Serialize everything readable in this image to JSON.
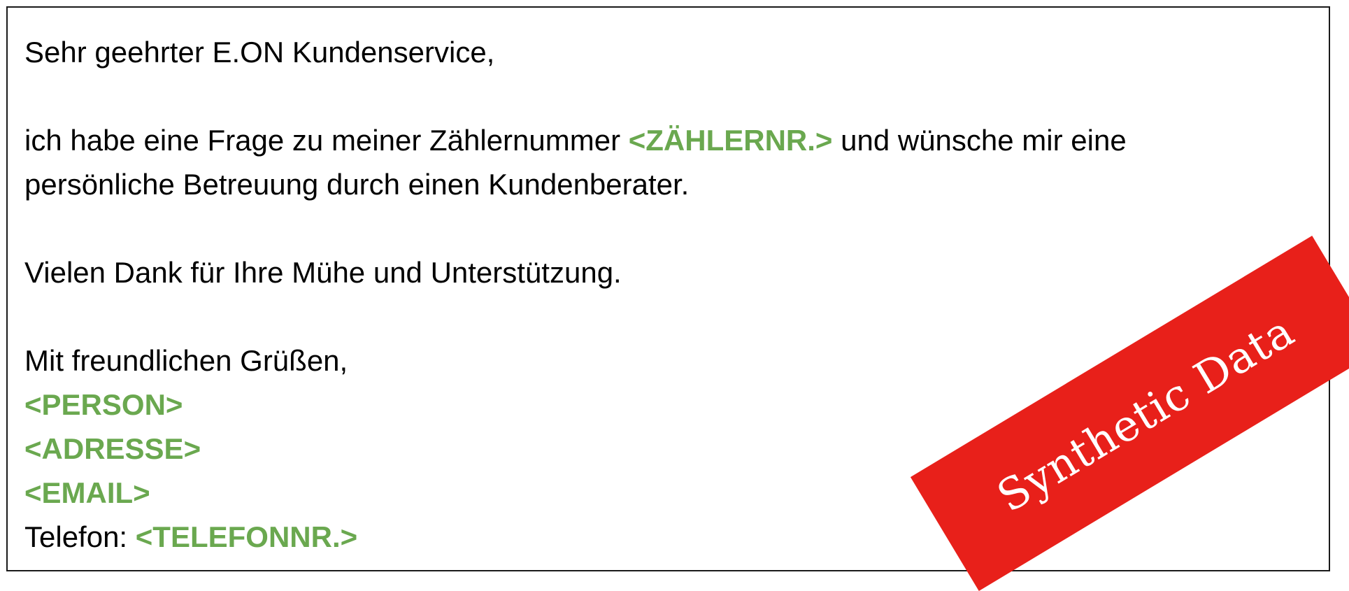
{
  "letter": {
    "salutation": "Sehr geehrter E.ON Kundenservice,",
    "body_line1_prefix": "ich habe eine Frage zu meiner Zählernummer ",
    "meter_placeholder": "<ZÄHLERNR.>",
    "body_line1_suffix": " und wünsche mir eine",
    "body_line2": "persönliche Betreuung durch einen Kundenberater.",
    "thanks": "Vielen Dank für Ihre Mühe und Unterstützung.",
    "closing": "Mit freundlichen Grüßen,",
    "person_placeholder": "<PERSON>",
    "address_placeholder": "<ADRESSE>",
    "email_placeholder": "<EMAIL>",
    "phone_label": "Telefon: ",
    "phone_placeholder": "<TELEFONNR.>"
  },
  "stamp": {
    "text": "Synthetic Data"
  },
  "colors": {
    "placeholder": "#6aa84f",
    "stamp_background": "#e8201a",
    "stamp_text": "#ffffff",
    "border": "#1a1a1a"
  }
}
